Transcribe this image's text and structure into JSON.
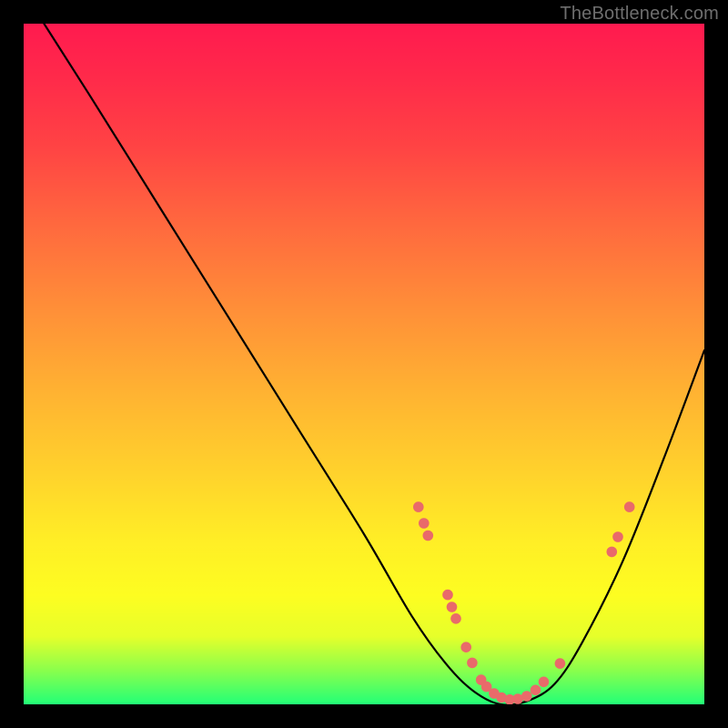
{
  "watermark": "TheBottleneck.com",
  "chart_data": {
    "type": "line",
    "title": "",
    "xlabel": "",
    "ylabel": "",
    "xlim": [
      0,
      100
    ],
    "ylim": [
      0,
      100
    ],
    "series": [
      {
        "name": "curve",
        "x": [
          3,
          10,
          20,
          30,
          40,
          50,
          57,
          62,
          66,
          70,
          74,
          78,
          82,
          88,
          94,
          100
        ],
        "y": [
          100,
          89,
          73,
          57,
          41,
          25,
          13,
          6,
          2,
          0,
          0.5,
          3,
          9,
          21,
          36,
          52
        ]
      }
    ],
    "markers": [
      {
        "name": "left-cluster-top",
        "x": 58.0,
        "y": 29.0
      },
      {
        "name": "left-cluster-a",
        "x": 58.8,
        "y": 26.6
      },
      {
        "name": "left-cluster-b",
        "x": 59.4,
        "y": 24.8
      },
      {
        "name": "left-mid-a",
        "x": 62.3,
        "y": 16.1
      },
      {
        "name": "left-mid-b",
        "x": 62.9,
        "y": 14.3
      },
      {
        "name": "left-mid-c",
        "x": 63.5,
        "y": 12.6
      },
      {
        "name": "left-low-a",
        "x": 65.0,
        "y": 8.4
      },
      {
        "name": "left-low-b",
        "x": 65.9,
        "y": 6.1
      },
      {
        "name": "bottom-a",
        "x": 67.2,
        "y": 3.6
      },
      {
        "name": "bottom-b",
        "x": 68.0,
        "y": 2.6
      },
      {
        "name": "bottom-c",
        "x": 69.1,
        "y": 1.6
      },
      {
        "name": "bottom-d",
        "x": 70.2,
        "y": 1.0
      },
      {
        "name": "bottom-e",
        "x": 71.4,
        "y": 0.7
      },
      {
        "name": "bottom-f",
        "x": 72.6,
        "y": 0.8
      },
      {
        "name": "bottom-g",
        "x": 73.9,
        "y": 1.2
      },
      {
        "name": "bottom-h",
        "x": 75.2,
        "y": 2.1
      },
      {
        "name": "bottom-i",
        "x": 76.4,
        "y": 3.3
      },
      {
        "name": "right-low",
        "x": 78.8,
        "y": 6.0
      },
      {
        "name": "right-cluster-a",
        "x": 86.4,
        "y": 22.4
      },
      {
        "name": "right-cluster-b",
        "x": 87.3,
        "y": 24.6
      },
      {
        "name": "right-cluster-c",
        "x": 89.0,
        "y": 29.0
      }
    ]
  }
}
